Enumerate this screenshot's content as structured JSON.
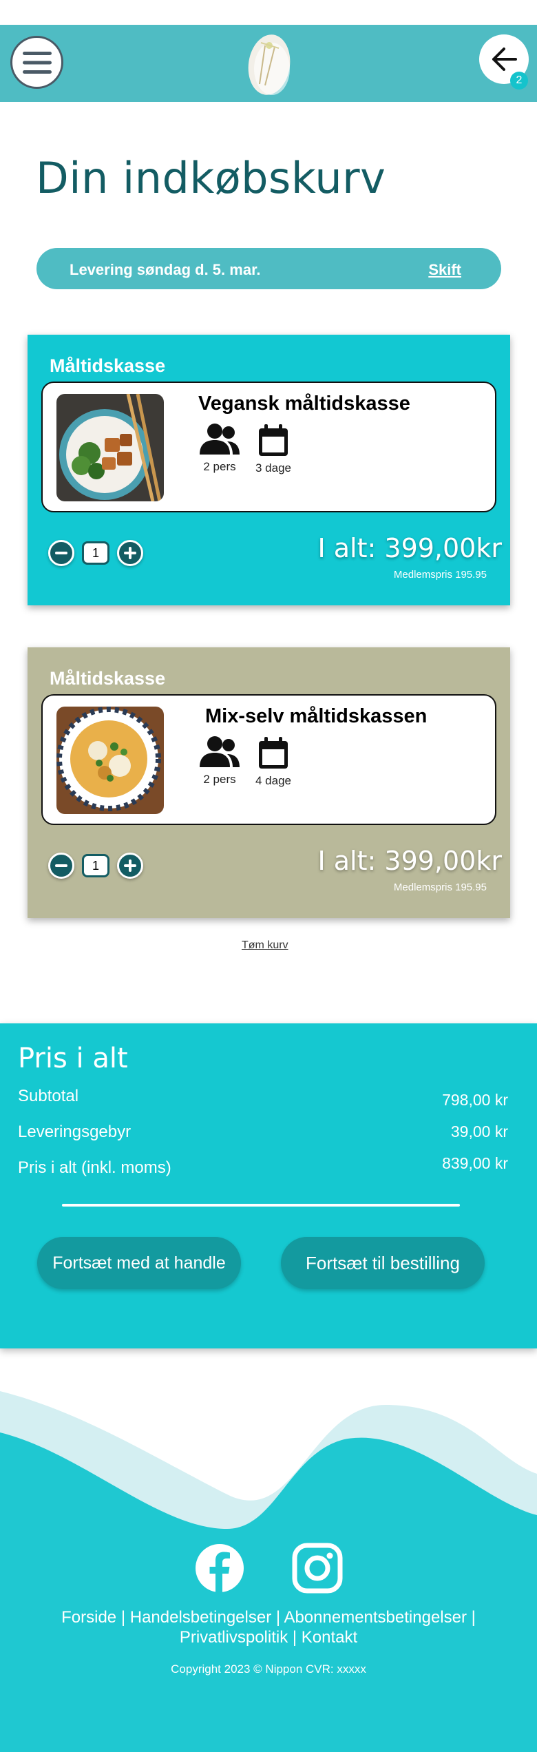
{
  "header": {
    "menu_icon": "hamburger-menu-icon",
    "logo": "nippon-logo",
    "back_icon": "arrow-left-icon",
    "cart_count": "2"
  },
  "page": {
    "title": "Din indkøbskurv"
  },
  "delivery": {
    "text": "Levering søndag d. 5. mar.",
    "change_label": "Skift"
  },
  "cart": {
    "items": [
      {
        "category": "Måltidskasse",
        "name": "Vegansk måltidskasse",
        "persons": "2 pers",
        "days": "3 dage",
        "quantity": "1",
        "total": "I alt: 399,00kr",
        "member_price": "Medlemspris 195.95",
        "background": "#12c8d2"
      },
      {
        "category": "Måltidskasse",
        "name": "Mix-selv måltidskassen",
        "persons": "2 pers",
        "days": "4 dage",
        "quantity": "1",
        "total": "I alt: 399,00kr",
        "member_price": "Medlemspris 195.95",
        "background": "#b9b99a"
      }
    ],
    "empty_label": "Tøm kurv"
  },
  "summary": {
    "title": "Pris i alt",
    "rows": [
      {
        "label": "Subtotal",
        "value": "798,00 kr"
      },
      {
        "label": "Leveringsgebyr",
        "value": "39,00 kr"
      },
      {
        "label": "Pris i alt (inkl. moms)",
        "value": "839,00 kr"
      }
    ],
    "continue_label": "Fortsæt med at handle",
    "checkout_label": "Fortsæt til bestilling"
  },
  "footer": {
    "links": [
      "Forside",
      "Handelsbetingelser",
      "Abonnementsbetingelser",
      "Privatlivspolitik",
      "Kontakt"
    ],
    "separator": " | ",
    "copyright": "Copyright 2023 © Nippon CVR: xxxxx"
  },
  "colors": {
    "accent": "#15c8d0",
    "header": "#4fbcc3",
    "dark_teal": "#135c63",
    "button": "#139a9f",
    "card_olive": "#b9b99a"
  }
}
